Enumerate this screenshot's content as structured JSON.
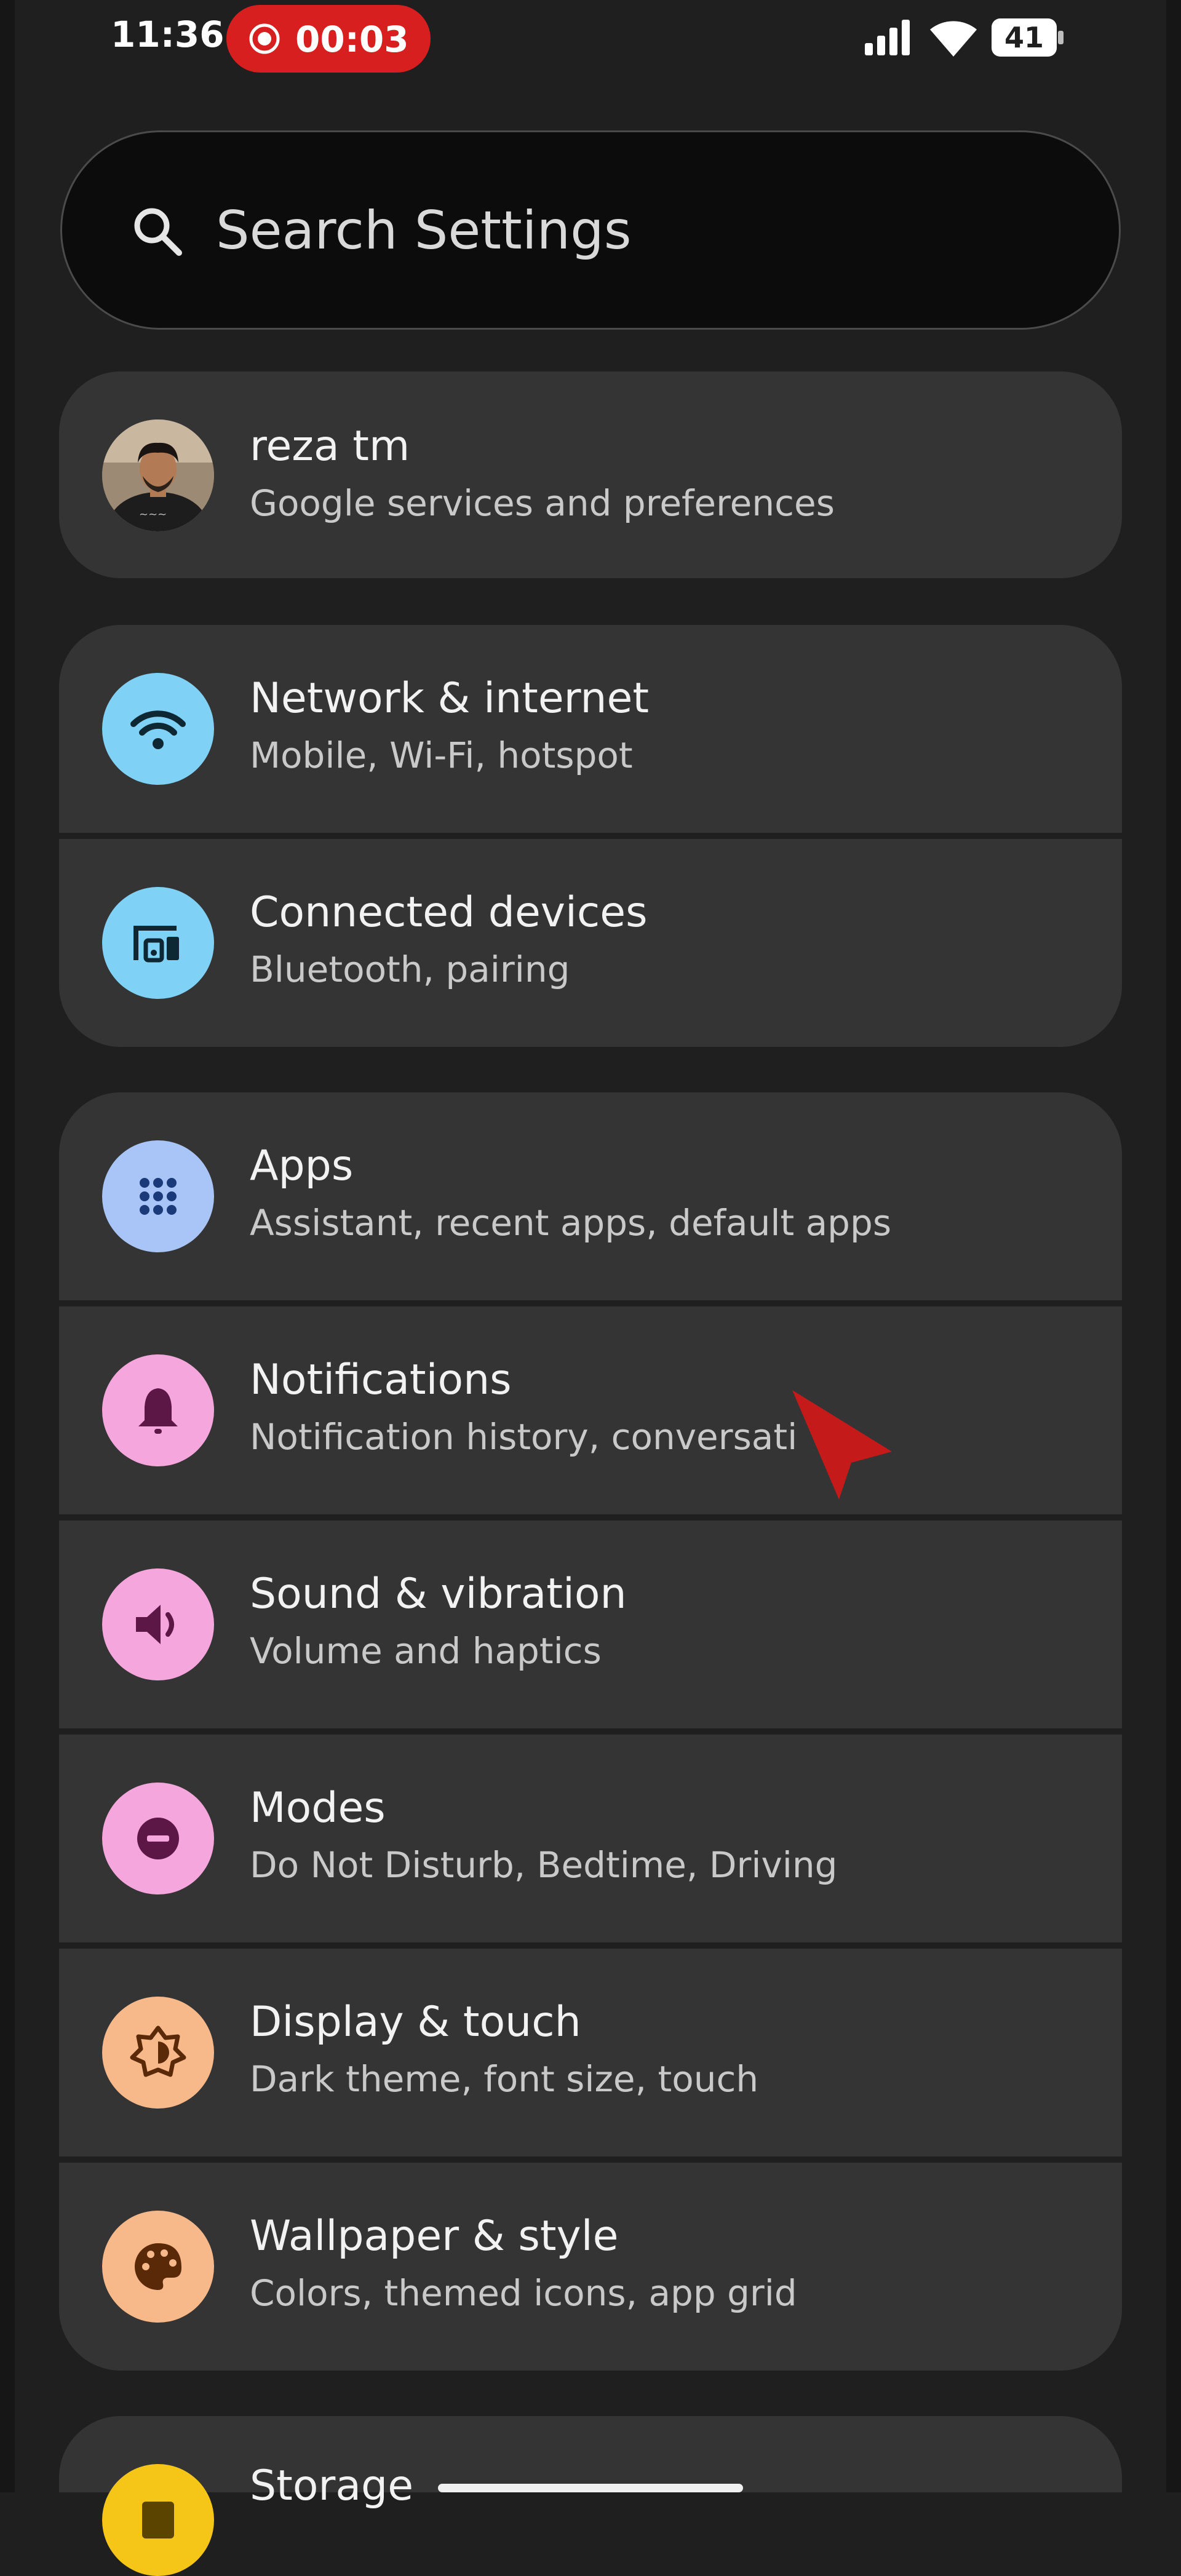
{
  "status_bar": {
    "time": "11:36",
    "recording_time": "00:03",
    "battery_level": "41",
    "recording_color": "#d81f1f"
  },
  "search": {
    "placeholder": "Search Settings",
    "icon": "search-icon"
  },
  "account": {
    "name": "reza tm",
    "subtitle": "Google services and preferences"
  },
  "groups": [
    {
      "items": [
        {
          "title": "Network & internet",
          "subtitle": "Mobile, Wi-Fi, hotspot",
          "icon": "wifi-icon",
          "color": "#7fd1f5"
        },
        {
          "title": "Connected devices",
          "subtitle": "Bluetooth, pairing",
          "icon": "connected-devices-icon",
          "color": "#7fd1f5"
        }
      ]
    },
    {
      "items": [
        {
          "title": "Apps",
          "subtitle": "Assistant, recent apps, default apps",
          "icon": "apps-grid-icon",
          "color": "#a9c4f7"
        },
        {
          "title": "Notifications",
          "subtitle": "Notification history, conversati",
          "icon": "bell-icon",
          "color": "#f5a6dc"
        },
        {
          "title": "Sound & vibration",
          "subtitle": "Volume and haptics",
          "icon": "speaker-icon",
          "color": "#f5a6dc"
        },
        {
          "title": "Modes",
          "subtitle": "Do Not Disturb, Bedtime, Driving",
          "icon": "do-not-disturb-icon",
          "color": "#f5a6dc"
        },
        {
          "title": "Display & touch",
          "subtitle": "Dark theme, font size, touch",
          "icon": "brightness-icon",
          "color": "#f7b88a"
        },
        {
          "title": "Wallpaper & style",
          "subtitle": "Colors, themed icons, app grid",
          "icon": "palette-icon",
          "color": "#f7b88a"
        }
      ]
    },
    {
      "items": [
        {
          "title": "Storage",
          "icon": "storage-icon",
          "color": "#f5c518"
        }
      ]
    }
  ],
  "colors": {
    "background": "#1f1f1f",
    "card": "#343434",
    "cursor": "#c41a1a"
  }
}
